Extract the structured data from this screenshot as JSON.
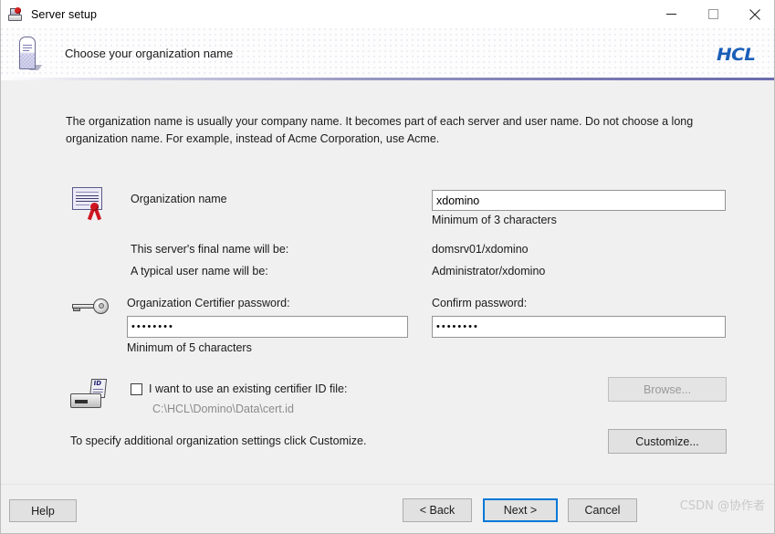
{
  "window": {
    "title": "Server setup",
    "icon": "server-setup-icon",
    "controls": {
      "minimize": "minimize-icon",
      "maximize": "maximize-icon",
      "close": "close-icon"
    }
  },
  "header": {
    "title": "Choose your organization name",
    "brand": "HCL",
    "icon": "server-monolith-icon",
    "brand_color": "#1a5fb8"
  },
  "body": {
    "intro": "The organization name is usually your company name. It becomes part of each server and user name. Do not choose a long organization name. For example, instead of Acme Corporation, use Acme.",
    "org_name": {
      "icon": "certificate-icon",
      "label": "Organization name",
      "value": "xdomino",
      "hint": "Minimum of 3 characters"
    },
    "server_name": {
      "label": "This server's final name will be:",
      "value": "domsrv01/xdomino"
    },
    "user_name": {
      "label": "A typical user name will be:",
      "value": "Administrator/xdomino"
    },
    "certifier_password": {
      "icon": "key-icon",
      "label": "Organization Certifier password:",
      "value": "••••••••",
      "hint": "Minimum of 5 characters"
    },
    "confirm_password": {
      "label": "Confirm password:",
      "value": "••••••••"
    },
    "existing_id": {
      "icon": "id-card-reader-icon",
      "checkbox_label": "I want to use an existing certifier ID file:",
      "checked": false,
      "path": "C:\\HCL\\Domino\\Data\\cert.id",
      "browse_label": "Browse...",
      "browse_enabled": false
    },
    "customize": {
      "note": "To specify additional organization settings click Customize.",
      "label": "Customize..."
    }
  },
  "footer": {
    "help": "Help",
    "back": "< Back",
    "next": "Next >",
    "cancel": "Cancel",
    "watermark": "CSDN @协作者",
    "focus_color": "#0078d7"
  }
}
